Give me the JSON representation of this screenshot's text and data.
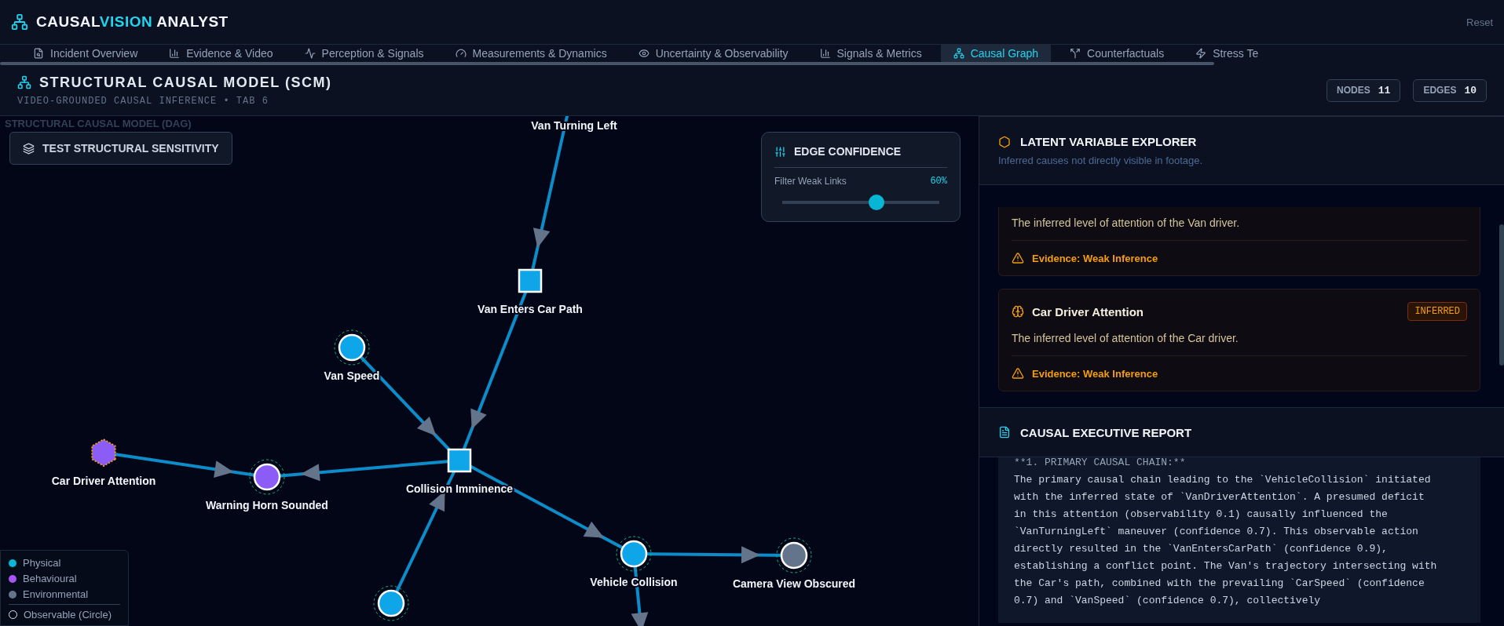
{
  "app": {
    "title_start": "CAUSAL",
    "title_accent": "VISION",
    "title_end": " ANALYST",
    "reset": "Reset"
  },
  "tabs": [
    {
      "label": "Incident Overview",
      "selected": false
    },
    {
      "label": "Evidence & Video",
      "selected": false
    },
    {
      "label": "Perception & Signals",
      "selected": false
    },
    {
      "label": "Measurements & Dynamics",
      "selected": false
    },
    {
      "label": "Uncertainty & Observability",
      "selected": false
    },
    {
      "label": "Signals & Metrics",
      "selected": false
    },
    {
      "label": "Causal Graph",
      "selected": true
    },
    {
      "label": "Counterfactuals",
      "selected": false
    },
    {
      "label": "Stress Te",
      "selected": false
    }
  ],
  "model_header": {
    "title": "STRUCTURAL CAUSAL MODEL (SCM)",
    "subtitle": "VIDEO-GROUNDED CAUSAL INFERENCE • TAB 6",
    "stats": [
      {
        "label": "NODES",
        "value": "11"
      },
      {
        "label": "EDGES",
        "value": "10"
      }
    ]
  },
  "canvas": {
    "ghost_title": "STRUCTURAL CAUSAL MODEL (DAG)",
    "sensitivity_button": "TEST STRUCTURAL SENSITIVITY",
    "edge_confidence": {
      "title": "EDGE CONFIDENCE",
      "filter_label": "Filter Weak Links",
      "reading": "60%",
      "level": 0.6
    },
    "nodes": [
      {
        "label": "Van Turning Left"
      },
      {
        "label": "Van Enters Car Path",
        "kind": "square",
        "color": "#0ea5e9"
      },
      {
        "label": "Van Speed",
        "kind": "circle",
        "color": "#0ea5e9"
      },
      {
        "label": "Collision Imminence",
        "kind": "square",
        "color": "#0ea5e9"
      },
      {
        "label": "Car Driver Attention",
        "kind": "hexagon",
        "color": "#8b5cf6"
      },
      {
        "label": "Warning Horn Sounded",
        "kind": "circle",
        "color": "#8b5cf6"
      },
      {
        "label": "Vehicle Collision",
        "kind": "circle",
        "color": "#0ea5e9"
      },
      {
        "label": "Camera View Obscured",
        "kind": "circle",
        "color": "#64748b"
      },
      {
        "kind": "circle",
        "color": "#0ea5e9"
      }
    ],
    "legend": [
      {
        "label": "Physical",
        "color": "#06b6d4"
      },
      {
        "label": "Behavioural",
        "color": "#a855f7"
      },
      {
        "label": "Environmental",
        "color": "#64748b"
      }
    ],
    "legend_shape": "Observable (Circle)"
  },
  "latent": {
    "title": "LATENT VARIABLE EXPLORER",
    "subtitle": "Inferred causes not directly visible in footage.",
    "cards": [
      {
        "description": "The inferred level of attention of the Van driver.",
        "evidence": "Evidence: Weak Inference"
      },
      {
        "title": "Car Driver Attention",
        "badge": "INFERRED",
        "description": "The inferred level of attention of the Car driver.",
        "evidence": "Evidence: Weak Inference"
      }
    ]
  },
  "report": {
    "title": "CAUSAL EXECUTIVE REPORT",
    "heading": "**1. PRIMARY CAUSAL CHAIN:**",
    "body": "The primary causal chain leading to the `VehicleCollision` initiated with the inferred state of `VanDriverAttention`. A presumed deficit in this attention (observability 0.1) causally influenced the `VanTurningLeft` maneuver (confidence 0.7). This observable action directly resulted in the `VanEntersCarPath` (confidence 0.9), establishing a conflict point. The Van's trajectory intersecting with the Car's path, combined with the prevailing `CarSpeed` (confidence 0.7) and `VanSpeed` (confidence 0.7), collectively"
  }
}
